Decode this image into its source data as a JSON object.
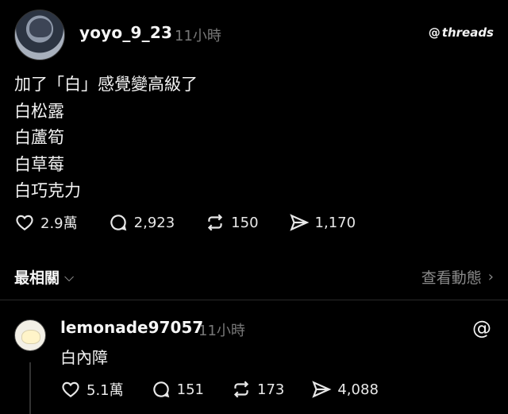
{
  "post": {
    "username": "yoyo_9_23",
    "time": "11小時",
    "brand": "threads",
    "lines": [
      "加了「白」感覺變高級了",
      "白松露",
      "白蘆筍",
      "白草莓",
      "白巧克力"
    ],
    "likes": "2.9萬",
    "comments": "2,923",
    "reposts": "150",
    "shares": "1,170"
  },
  "sort": {
    "label": "最相關",
    "view_activity": "查看動態"
  },
  "reply": {
    "username": "lemonade97057",
    "time": "11小時",
    "text": "白內障",
    "likes": "5.1萬",
    "comments": "151",
    "reposts": "173",
    "shares": "4,088"
  }
}
